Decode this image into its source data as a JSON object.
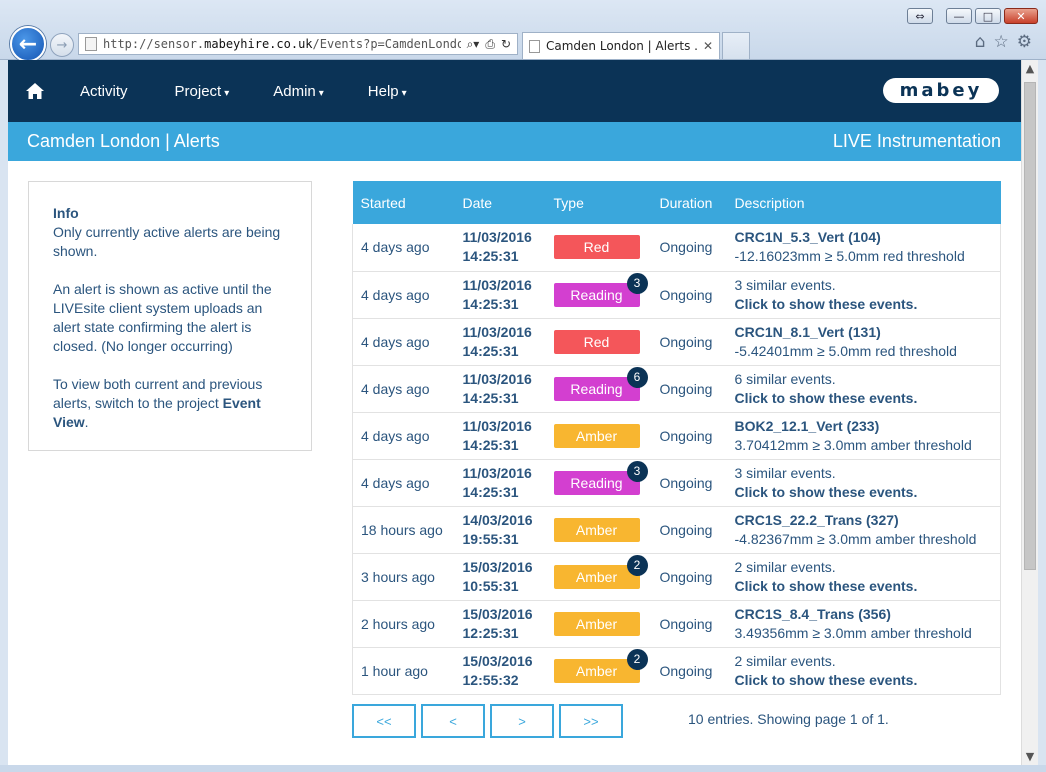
{
  "browser": {
    "url_prefix": "http://sensor.",
    "url_domain": "mabeyhire.co.uk",
    "url_path": "/Events?p=CamdenLondon.s",
    "tab_title": "Camden London | Alerts ..."
  },
  "nav": {
    "items": [
      {
        "label": "Activity",
        "caret": ""
      },
      {
        "label": "Project",
        "caret": "▾"
      },
      {
        "label": "Admin",
        "caret": "▾"
      },
      {
        "label": "Help",
        "caret": "▾"
      }
    ],
    "logo_text": "mabey"
  },
  "titlebar": {
    "title": "Camden London | Alerts",
    "right": "LIVE Instrumentation"
  },
  "info": {
    "heading": "Info",
    "p1": "Only currently active alerts are being shown.",
    "p2": "An alert is shown as active until the LIVEsite client system uploads an alert state confirming the alert is closed. (No longer occurring)",
    "p3_pre": "To view both current and previous alerts, switch to the project ",
    "p3_bold": "Event View",
    "p3_post": "."
  },
  "table": {
    "headers": [
      "Started",
      "Date",
      "Type",
      "Duration",
      "Description"
    ],
    "rows": [
      {
        "started": "4 days ago",
        "date1": "11/03/2016",
        "date2": "14:25:31",
        "type": "Red",
        "kind": "red",
        "count": "",
        "duration": "Ongoing",
        "desc1": "CRC1N_5.3_Vert (104)",
        "desc2": "-12.16023mm ≥ 5.0mm red threshold",
        "bold1": true
      },
      {
        "started": "4 days ago",
        "date1": "11/03/2016",
        "date2": "14:25:31",
        "type": "Reading",
        "kind": "reading",
        "count": "3",
        "duration": "Ongoing",
        "desc1": "3 similar events.",
        "desc2": "Click to show these events.",
        "bold1": false
      },
      {
        "started": "4 days ago",
        "date1": "11/03/2016",
        "date2": "14:25:31",
        "type": "Red",
        "kind": "red",
        "count": "",
        "duration": "Ongoing",
        "desc1": "CRC1N_8.1_Vert (131)",
        "desc2": "-5.42401mm ≥ 5.0mm red threshold",
        "bold1": true
      },
      {
        "started": "4 days ago",
        "date1": "11/03/2016",
        "date2": "14:25:31",
        "type": "Reading",
        "kind": "reading",
        "count": "6",
        "duration": "Ongoing",
        "desc1": "6 similar events.",
        "desc2": "Click to show these events.",
        "bold1": false
      },
      {
        "started": "4 days ago",
        "date1": "11/03/2016",
        "date2": "14:25:31",
        "type": "Amber",
        "kind": "amber",
        "count": "",
        "duration": "Ongoing",
        "desc1": "BOK2_12.1_Vert (233)",
        "desc2": "3.70412mm ≥ 3.0mm amber threshold",
        "bold1": true
      },
      {
        "started": "4 days ago",
        "date1": "11/03/2016",
        "date2": "14:25:31",
        "type": "Reading",
        "kind": "reading",
        "count": "3",
        "duration": "Ongoing",
        "desc1": "3 similar events.",
        "desc2": "Click to show these events.",
        "bold1": false
      },
      {
        "started": "18 hours ago",
        "date1": "14/03/2016",
        "date2": "19:55:31",
        "type": "Amber",
        "kind": "amber",
        "count": "",
        "duration": "Ongoing",
        "desc1": "CRC1S_22.2_Trans (327)",
        "desc2": "-4.82367mm ≥ 3.0mm amber threshold",
        "bold1": true
      },
      {
        "started": "3 hours ago",
        "date1": "15/03/2016",
        "date2": "10:55:31",
        "type": "Amber",
        "kind": "amber",
        "count": "2",
        "duration": "Ongoing",
        "desc1": "2 similar events.",
        "desc2": "Click to show these events.",
        "bold1": false
      },
      {
        "started": "2 hours ago",
        "date1": "15/03/2016",
        "date2": "12:25:31",
        "type": "Amber",
        "kind": "amber",
        "count": "",
        "duration": "Ongoing",
        "desc1": "CRC1S_8.4_Trans (356)",
        "desc2": "3.49356mm ≥ 3.0mm amber threshold",
        "bold1": true
      },
      {
        "started": "1 hour ago",
        "date1": "15/03/2016",
        "date2": "12:55:32",
        "type": "Amber",
        "kind": "amber",
        "count": "2",
        "duration": "Ongoing",
        "desc1": "2 similar events.",
        "desc2": "Click to show these events.",
        "bold1": false
      }
    ]
  },
  "pager": {
    "buttons": [
      "<<",
      "<",
      ">",
      ">>"
    ],
    "summary": "10 entries. Showing page 1 of 1."
  },
  "colors": {
    "nav": "#0b3356",
    "accent": "#3aa7dc",
    "red": "#f4565a",
    "reading": "#d33fd0",
    "amber": "#f8b630"
  }
}
